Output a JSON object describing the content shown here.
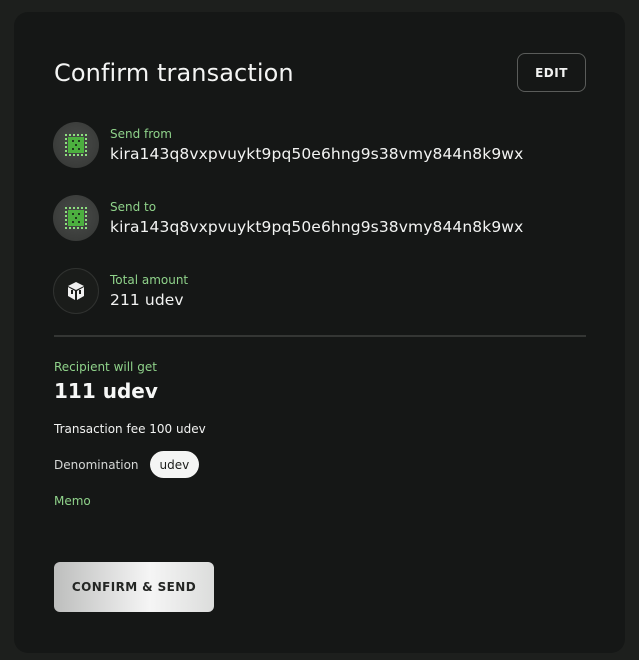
{
  "header": {
    "title": "Confirm transaction",
    "edit_label": "EDIT"
  },
  "send_from": {
    "label": "Send from",
    "value": "kira143q8vxpvuykt9pq50e6hng9s38vmy844n8k9wx",
    "icon": "identicon-icon"
  },
  "send_to": {
    "label": "Send to",
    "value": "kira143q8vxpvuykt9pq50e6hng9s38vmy844n8k9wx",
    "icon": "identicon-icon"
  },
  "total": {
    "label": "Total amount",
    "value": "211 udev",
    "icon": "token-icon"
  },
  "recipient": {
    "label": "Recipient will get",
    "value": "111 udev"
  },
  "fee": {
    "text": "Transaction fee 100 udev"
  },
  "denomination": {
    "label": "Denomination",
    "value": "udev"
  },
  "memo": {
    "label": "Memo"
  },
  "actions": {
    "confirm_label": "CONFIRM & SEND"
  },
  "colors": {
    "accent": "#8fd28a",
    "identicon_green": "#4caf3f",
    "card_bg": "#151716",
    "page_bg": "#1d1f1d"
  }
}
